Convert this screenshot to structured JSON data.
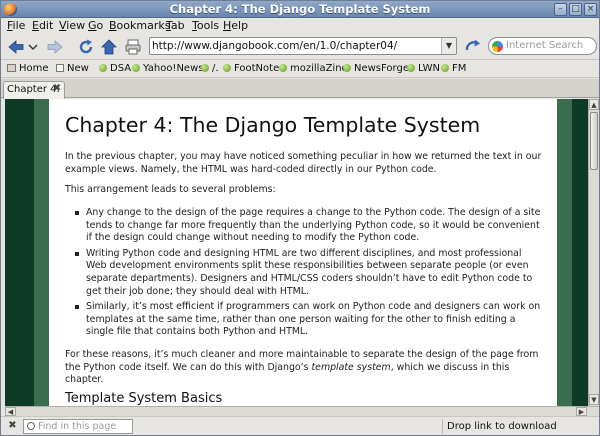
{
  "window": {
    "title": "Chapter 4: The Django Template System"
  },
  "menu": [
    "File",
    "Edit",
    "View",
    "Go",
    "Bookmarks",
    "Tab",
    "Tools",
    "Help"
  ],
  "address": {
    "url": "http://www.djangobook.com/en/1.0/chapter04/"
  },
  "search": {
    "placeholder": "Internet Search"
  },
  "bookmarks": [
    "Home",
    "New",
    "DSA",
    "Yahoo!News",
    "/.",
    "FootNote",
    "mozillaZine",
    "NewsForge",
    "LWN",
    "FM"
  ],
  "tab": {
    "label": "Chapter 4:"
  },
  "page": {
    "heading": "Chapter 4: The Django Template System",
    "intro": "In the previous chapter, you may have noticed something peculiar in how we returned the text in our example views. Namely, the HTML was hard-coded directly in our Python code.",
    "problems_lead": "This arrangement leads to several problems:",
    "bullets": [
      "Any change to the design of the page requires a change to the Python code. The design of a site tends to change far more frequently than the underlying Python code, so it would be convenient if the design could change without needing to modify the Python code.",
      "Writing Python code and designing HTML are two different disciplines, and most professional Web development environments split these responsibilities between separate people (or even separate departments). Designers and HTML/CSS coders shouldn’t have to edit Python code to get their job done; they should deal with HTML.",
      "Similarly, it’s most efficient if programmers can work on Python code and designers can work on templates at the same time, rather than one person waiting for the other to finish editing a single file that contains both Python and HTML."
    ],
    "conclusion_before": "For these reasons, it’s much cleaner and more maintainable to separate the design of the page from the Python code itself. We can do this with Django’s ",
    "conclusion_em": "template system",
    "conclusion_after": ", which we discuss in this chapter.",
    "subheading": "Template System Basics"
  },
  "findbar": {
    "placeholder": "Find in this page"
  },
  "status": {
    "text": "Drop link to download"
  }
}
